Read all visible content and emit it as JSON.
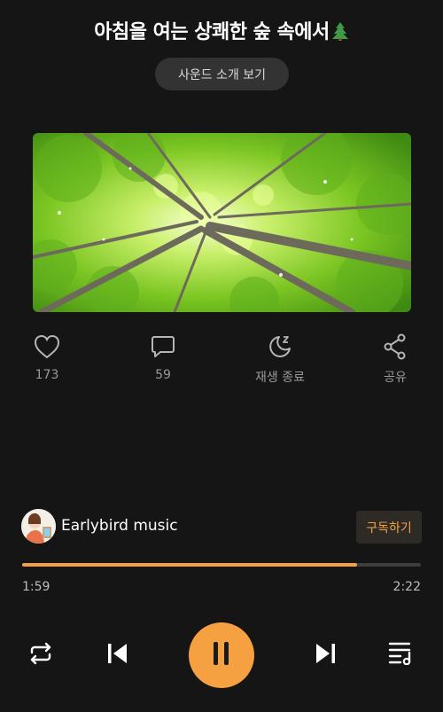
{
  "header": {
    "title": "아침을 여는 상쾌한 숲 속에서",
    "title_icon": "evergreen-tree-icon",
    "intro_button": "사운드 소개 보기"
  },
  "actions": {
    "like": {
      "icon": "heart-icon",
      "label": "173"
    },
    "comment": {
      "icon": "comment-icon",
      "label": "59"
    },
    "sleep_timer": {
      "icon": "moon-zzz-icon",
      "label": "재생 종료"
    },
    "share": {
      "icon": "share-icon",
      "label": "공유"
    }
  },
  "artist": {
    "name": "Earlybird music",
    "subscribe_label": "구독하기"
  },
  "player": {
    "current_time": "1:59",
    "total_time": "2:22",
    "progress": 0.84
  },
  "controls": [
    "repeat-icon",
    "previous-track-icon",
    "pause-icon",
    "next-track-icon",
    "playlist-icon"
  ],
  "colors": {
    "accent": "#f5a142",
    "background": "#151515"
  }
}
